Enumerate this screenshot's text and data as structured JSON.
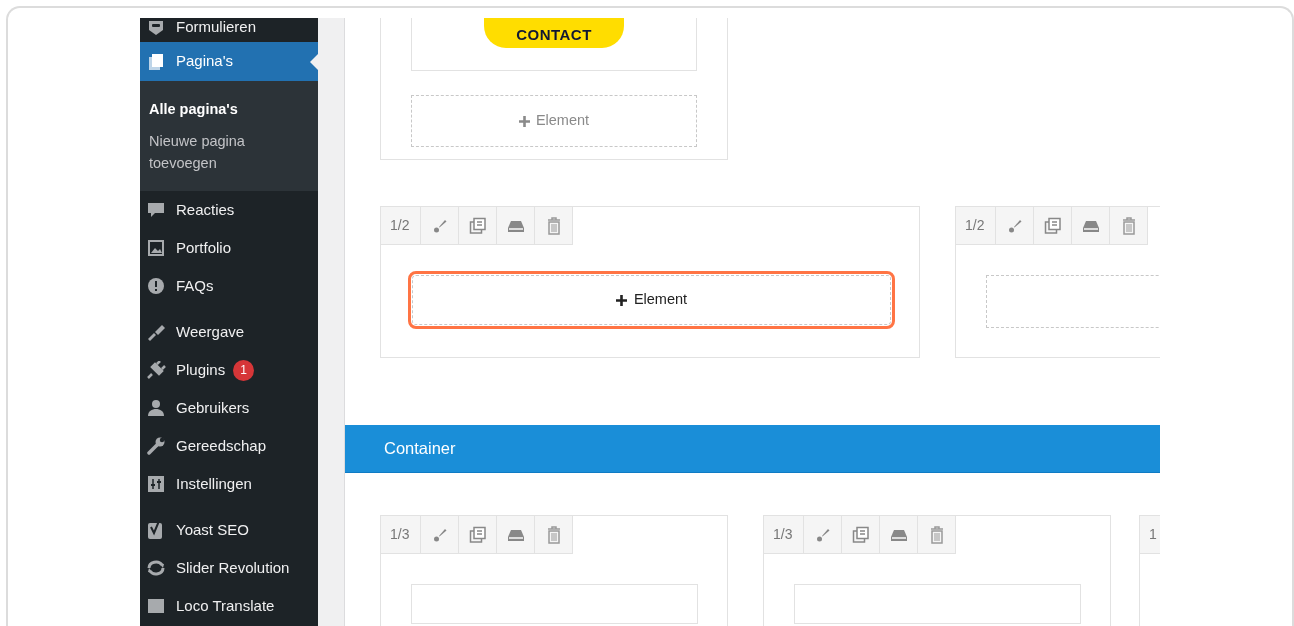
{
  "sidebar": {
    "groups": [
      [
        {
          "label": "Formulieren",
          "selected": false
        },
        {
          "label": "Pagina's",
          "selected": true,
          "children": [
            {
              "label": "Alle pagina's",
              "selected": true
            },
            {
              "label": "Nieuwe pagina toevoegen",
              "selected": false
            }
          ]
        },
        {
          "label": "Reacties",
          "selected": false
        },
        {
          "label": "Portfolio",
          "selected": false
        },
        {
          "label": "FAQs",
          "selected": false
        }
      ],
      [
        {
          "label": "Weergave",
          "selected": false
        },
        {
          "label": "Plugins",
          "selected": false,
          "badge": "1"
        },
        {
          "label": "Gebruikers",
          "selected": false
        },
        {
          "label": "Gereedschap",
          "selected": false
        },
        {
          "label": "Instellingen",
          "selected": false
        }
      ],
      [
        {
          "label": "Yoast SEO",
          "selected": false
        },
        {
          "label": "Slider Revolution",
          "selected": false
        },
        {
          "label": "Loco Translate",
          "selected": false
        }
      ]
    ]
  },
  "builder": {
    "top_card": {
      "button": "CONTACT",
      "add_label": "Element"
    },
    "row_1": [
      {
        "size": "1/2",
        "add_label": "Element",
        "highlighted": true
      },
      {
        "size": "1/2",
        "highlighted": false
      }
    ],
    "container": {
      "title": "Container"
    },
    "row_2": [
      {
        "size": "1/3"
      },
      {
        "size": "1/3"
      },
      {
        "size": "1"
      }
    ]
  }
}
